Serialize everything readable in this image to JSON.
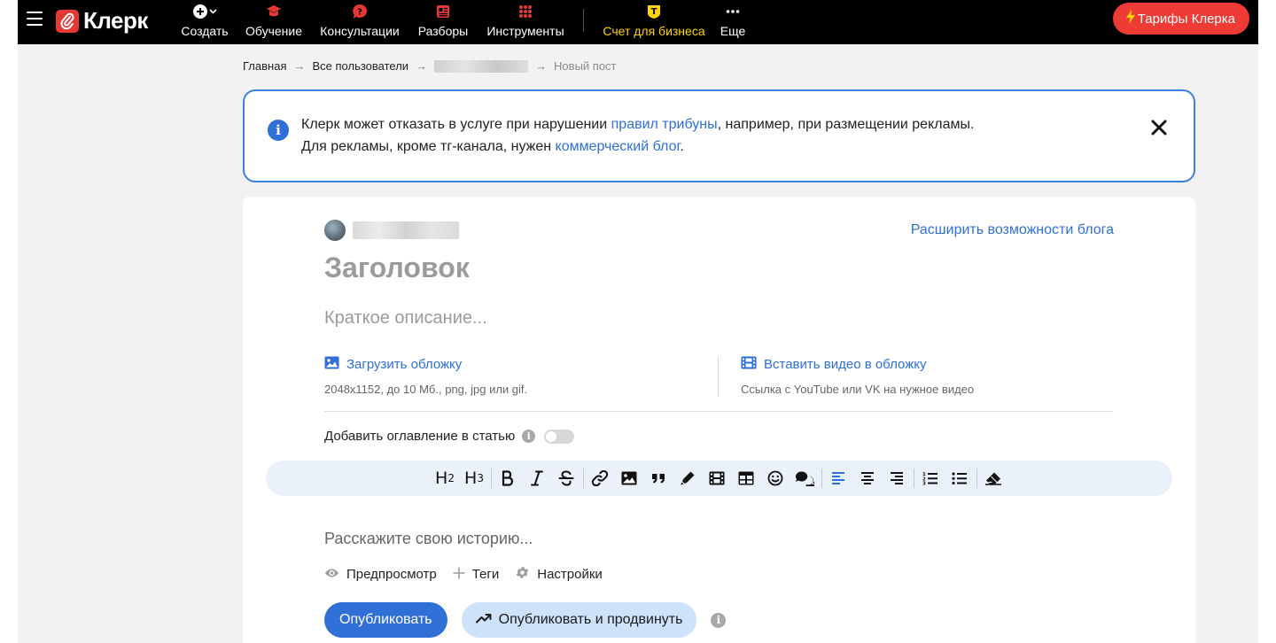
{
  "topbar": {
    "logo_text": "Клерк",
    "nav": [
      {
        "label": "Создать",
        "icon": "plus-circle-icon"
      },
      {
        "label": "Обучение",
        "icon": "graduation-icon"
      },
      {
        "label": "Консультации",
        "icon": "question-bubble-icon"
      },
      {
        "label": "Разборы",
        "icon": "newspaper-icon"
      },
      {
        "label": "Инструменты",
        "icon": "grid-icon"
      },
      {
        "label": "Счет для бизнеса",
        "icon": "bank-shield-icon"
      },
      {
        "label": "Еще",
        "icon": "more-dots-icon"
      }
    ],
    "tariff_label": "Тарифы Клерка",
    "accent": "#ef3b36",
    "biz_color": "#ffd400"
  },
  "breadcrumb": {
    "home": "Главная",
    "users": "Все пользователи",
    "current": "Новый пост"
  },
  "notice": {
    "line1_before": "Клерк может отказать в услуге при нарушении ",
    "line1_link": "правил трибуны",
    "line1_after": ", например, при размещении рекламы.",
    "line2_before": "Для рекламы, кроме тг-канала, нужен ",
    "line2_link": "коммерческий блог",
    "line2_after": "."
  },
  "editor": {
    "expand_link": "Расширить возможности блога",
    "title_placeholder": "Заголовок",
    "desc_placeholder": "Краткое описание...",
    "cover_upload": "Загрузить обложку",
    "cover_hint": "2048x1152, до 10 Мб., png, jpg или gif.",
    "video_insert": "Вставить видео в обложку",
    "video_hint": "Ссылка с YouTube или VK на нужное видео",
    "toc_label": "Добавить оглавление в статью",
    "story_placeholder": "Расскажите свою историю...",
    "preview": "Предпросмотр",
    "tags": "Теги",
    "settings": "Настройки",
    "publish": "Опубликовать",
    "publish_promote": "Опубликовать и продвинуть"
  },
  "colors": {
    "link": "#2f6fd6",
    "notice_border": "#3d7fe0",
    "toolbar_bg": "#eaf1fb"
  }
}
